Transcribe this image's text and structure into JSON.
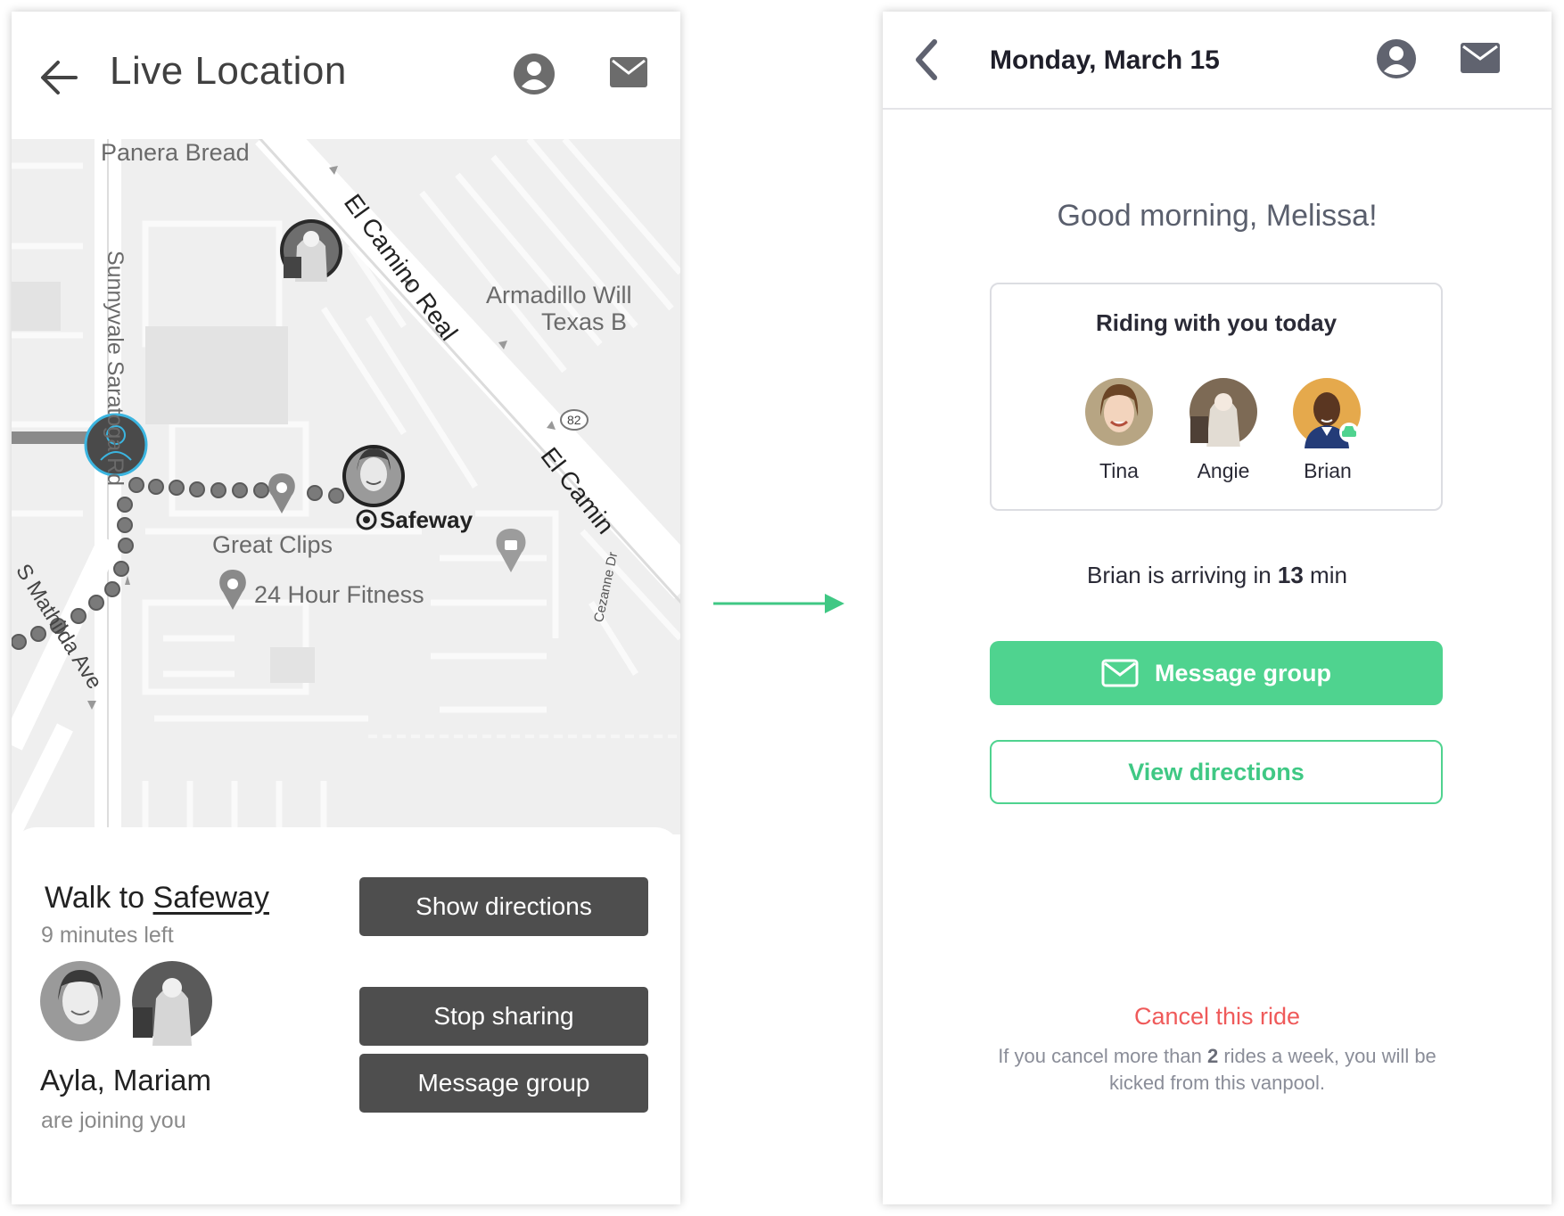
{
  "live_screen": {
    "title": "Live Location",
    "map_labels": {
      "panera": "Panera Bread",
      "sunnyvale": "Sunnyvale Saratoga Rd",
      "el_camino": "El Camino Real",
      "el_camino_2": "El Camin",
      "armadillo_1": "Armadillo Will",
      "armadillo_2": "Texas B",
      "route": "82",
      "safeway": "Safeway",
      "great_clips": "Great Clips",
      "fitness": "24 Hour Fitness",
      "matilda": "S Mathilda Ave",
      "cezanne": "Cezanne Dr"
    },
    "walk_prefix": "Walk to ",
    "walk_destination": "Safeway",
    "walk_time": "9 minutes left",
    "show_directions": "Show directions",
    "joining_names": "Ayla, Mariam",
    "joining_sub": "are joining you",
    "stop_sharing": "Stop sharing",
    "message_group": "Message group"
  },
  "ride_screen": {
    "date": "Monday, March 15",
    "greeting": "Good morning, Melissa!",
    "card_title": "Riding with you today",
    "riders": [
      {
        "name": "Tina"
      },
      {
        "name": "Angie"
      },
      {
        "name": "Brian"
      }
    ],
    "arrival_prefix": "Brian is arriving in ",
    "arrival_minutes": "13",
    "arrival_suffix": " min",
    "message_group": "Message group",
    "view_directions": "View directions",
    "cancel": "Cancel this ride",
    "warning_prefix": "If you cancel more than ",
    "warning_count": "2",
    "warning_suffix": " rides a week, you will be kicked from this vanpool."
  },
  "colors": {
    "accent_green": "#4fd38f",
    "cancel_red": "#ef5a5a",
    "dark_button": "#4e4e4e",
    "location_blue": "#3bb5e0"
  },
  "icons": [
    "back-arrow-icon",
    "user-icon",
    "mail-icon",
    "chevron-left-icon",
    "map-pin-icon",
    "car-icon",
    "flow-arrow-icon"
  ]
}
